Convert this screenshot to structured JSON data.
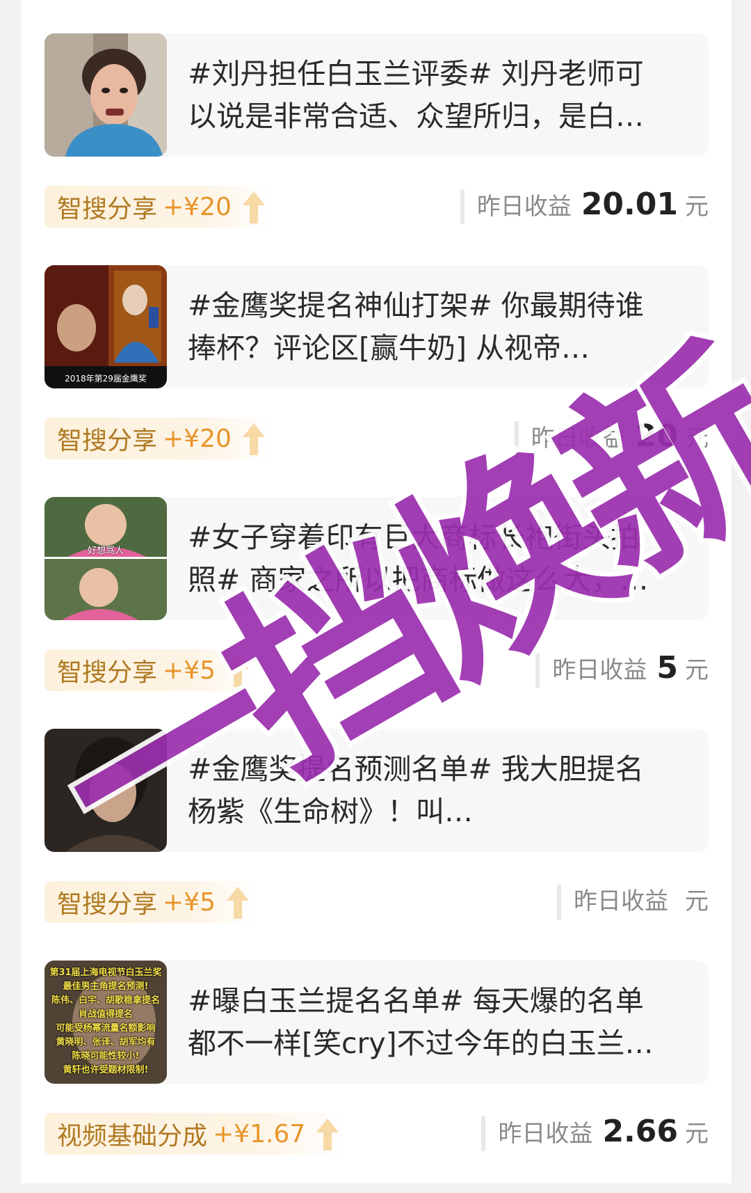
{
  "items": [
    {
      "title_line1": "#刘丹担任白玉兰评委# 刘丹老师可",
      "title_line2": "以说是非常合适、众望所归，是白…",
      "tag_label": "智搜分享",
      "tag_amount": "+¥20",
      "earn_label": "昨日收益",
      "earn_value": "20.01",
      "earn_unit": "元"
    },
    {
      "title_line1": "#金鹰奖提名神仙打架# 你最期待谁",
      "title_line2": "捧杯？评论区[赢牛奶] 从视帝…",
      "thumb_caption": "2018年第29届金鹰奖",
      "tag_label": "智搜分享",
      "tag_amount": "+¥20",
      "earn_label": "昨日收益",
      "earn_value": "20",
      "earn_unit": "元"
    },
    {
      "title_line1": "#女子穿着印有巨大商标长袍街头拍",
      "title_line2": "照# 商家之所以把商标做这么大，…",
      "thumb_caption": "好想骂人",
      "tag_label": "智搜分享",
      "tag_amount": "+¥5",
      "earn_label": "昨日收益",
      "earn_value": "5",
      "earn_unit": "元"
    },
    {
      "title_line1": "#金鹰奖提名预测名单# 我大胆提名",
      "title_line2": "杨紫《生命树》！叫…",
      "tag_label": "智搜分享",
      "tag_amount": "+¥5",
      "earn_label": "昨日收益",
      "earn_value": "",
      "earn_unit": "元"
    },
    {
      "title_line1": "#曝白玉兰提名名单# 每天爆的名单",
      "title_line2": "都不一样[笑cry]不过今年的白玉兰…",
      "thumb_caption_lines": [
        "第31届上海电视节白玉兰奖",
        "最佳男主角提名预测!",
        "陈伟、白宇、胡歌稳拿提名",
        "肖战值得提名",
        "可能受杨幂流量名额影响",
        "黄晓明、张译、胡军均有",
        "陈晓可能性较小!",
        "黄轩也许受题材限制!"
      ],
      "tag_label": "视频基础分成",
      "tag_amount": "+¥1.67",
      "earn_label": "昨日收益",
      "earn_value": "2.66",
      "earn_unit": "元"
    }
  ],
  "watermark": {
    "text": "一挡焕新",
    "color": "#9b2fae"
  }
}
